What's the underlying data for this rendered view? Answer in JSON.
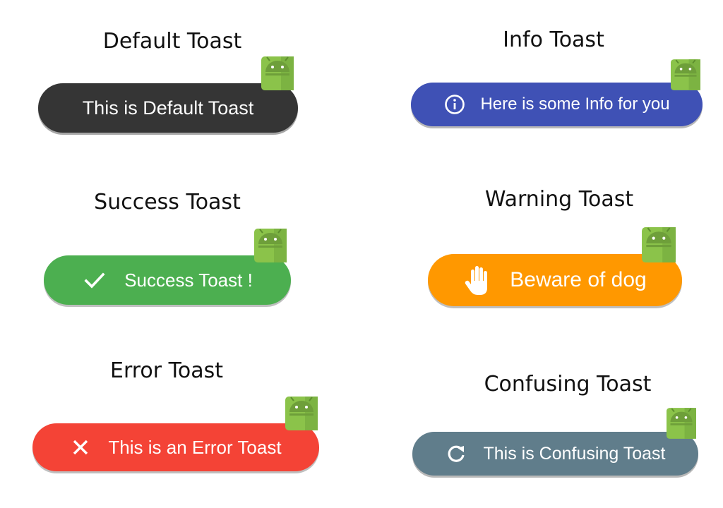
{
  "captions": {
    "default": "Default Toast",
    "info": "Info Toast",
    "success": "Success Toast",
    "warning": "Warning Toast",
    "error": "Error Toast",
    "confusing": "Confusing Toast"
  },
  "toasts": {
    "default": {
      "text": "This is Default Toast",
      "color": "#353535",
      "icon": "none"
    },
    "info": {
      "text": "Here is some Info for you",
      "color": "#3F51B5",
      "icon": "info-icon"
    },
    "success": {
      "text": "Success Toast !",
      "color": "#4CAF50",
      "icon": "checkmark-icon"
    },
    "warning": {
      "text": "Beware of dog",
      "color": "#FF9800",
      "icon": "hand-stop-icon"
    },
    "error": {
      "text": "This is an Error Toast",
      "color": "#F44336",
      "icon": "close-icon"
    },
    "confusing": {
      "text": "This is Confusing Toast",
      "color": "#607D8B",
      "icon": "refresh-icon"
    }
  },
  "android_badge": {
    "icon": "android-icon",
    "color": "#8BC34A"
  }
}
